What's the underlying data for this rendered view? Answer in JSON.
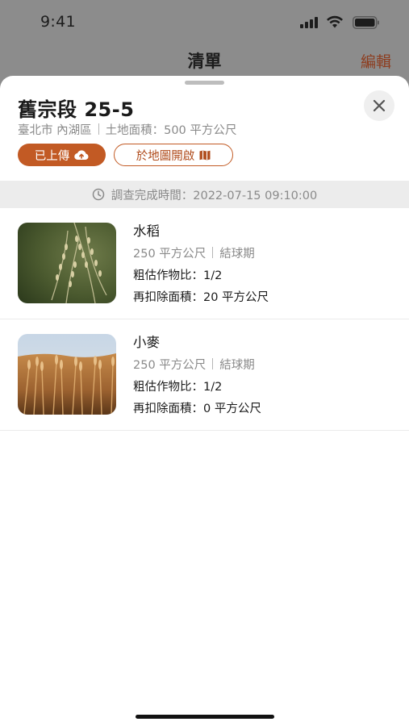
{
  "status_bar": {
    "time": "9:41"
  },
  "nav": {
    "title": "清單",
    "edit_label": "編輯"
  },
  "plot": {
    "title": "舊宗段 25-5",
    "location": "臺北市 內湖區",
    "land_area": "土地面積：500 平方公尺",
    "uploaded_label": "已上傳",
    "open_map_label": "於地圖開啟"
  },
  "survey": {
    "completed_text": "調查完成時間：2022-07-15 09:10:00"
  },
  "crops": [
    {
      "name": "水稻",
      "area": "250 平方公尺",
      "stage": "結球期",
      "ratio": "粗估作物比：1/2",
      "deduct": "再扣除面積：20 平方公尺",
      "image_icon": "rice-photo"
    },
    {
      "name": "小麥",
      "area": "250 平方公尺",
      "stage": "結球期",
      "ratio": "粗估作物比：1/2",
      "deduct": "再扣除面積：0 平方公尺",
      "image_icon": "wheat-photo"
    }
  ],
  "colors": {
    "accent": "#c25a24",
    "edit": "#8d3d1f",
    "muted": "#8a8a8a"
  },
  "icons": {
    "close": "close-icon",
    "upload": "cloud-upload-icon",
    "map": "map-icon",
    "clock": "clock-icon"
  }
}
